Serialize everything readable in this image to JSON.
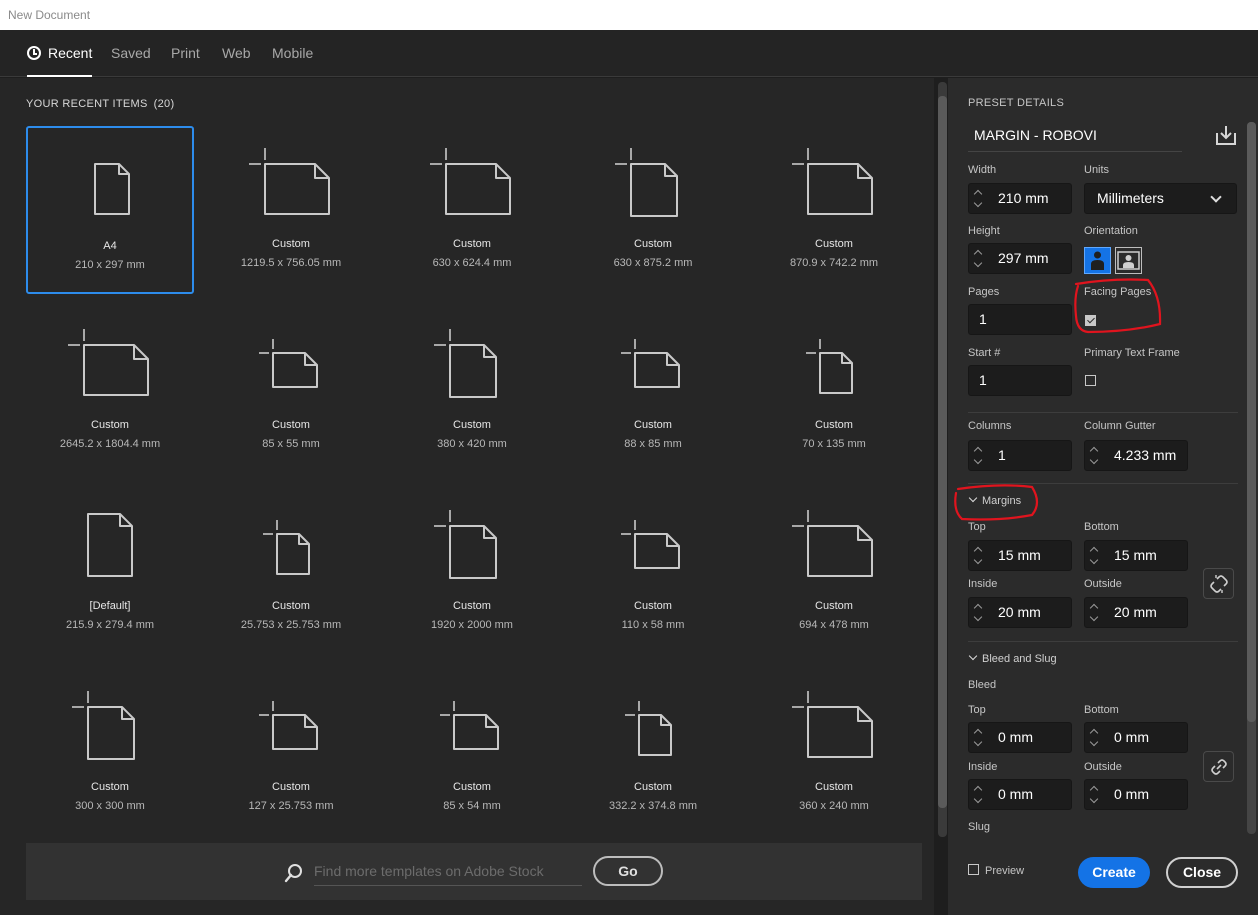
{
  "window": {
    "title": "New Document"
  },
  "tabs": [
    {
      "label": "Recent",
      "active": true
    },
    {
      "label": "Saved"
    },
    {
      "label": "Print"
    },
    {
      "label": "Web"
    },
    {
      "label": "Mobile"
    }
  ],
  "recent": {
    "title": "YOUR RECENT ITEMS",
    "count": "(20)",
    "items": [
      {
        "name": "A4",
        "size": "210 x 297 mm",
        "icon": "portrait-doc",
        "selected": true
      },
      {
        "name": "Custom",
        "size": "1219.5 x 756.05 mm",
        "icon": "custom-landscape"
      },
      {
        "name": "Custom",
        "size": "630 x 624.4 mm",
        "icon": "custom-landscape"
      },
      {
        "name": "Custom",
        "size": "630 x 875.2 mm",
        "icon": "custom-portrait"
      },
      {
        "name": "Custom",
        "size": "870.9 x 742.2 mm",
        "icon": "custom-landscape"
      },
      {
        "name": "Custom",
        "size": "2645.2 x 1804.4 mm",
        "icon": "custom-landscape"
      },
      {
        "name": "Custom",
        "size": "85 x 55 mm",
        "icon": "custom-small-landscape"
      },
      {
        "name": "Custom",
        "size": "380 x 420 mm",
        "icon": "custom-portrait"
      },
      {
        "name": "Custom",
        "size": "88 x 85 mm",
        "icon": "custom-small-landscape"
      },
      {
        "name": "Custom",
        "size": "70 x 135 mm",
        "icon": "custom-small-portrait"
      },
      {
        "name": "[Default]",
        "size": "215.9 x 279.4 mm",
        "icon": "portrait-doc-large"
      },
      {
        "name": "Custom",
        "size": "25.753 x 25.753 mm",
        "icon": "custom-small-portrait"
      },
      {
        "name": "Custom",
        "size": "1920 x 2000 mm",
        "icon": "custom-portrait"
      },
      {
        "name": "Custom",
        "size": "110 x 58 mm",
        "icon": "custom-small-landscape"
      },
      {
        "name": "Custom",
        "size": "694 x 478 mm",
        "icon": "custom-landscape"
      },
      {
        "name": "Custom",
        "size": "300 x 300 mm",
        "icon": "custom-portrait"
      },
      {
        "name": "Custom",
        "size": "127 x 25.753 mm",
        "icon": "custom-small-landscape"
      },
      {
        "name": "Custom",
        "size": "85 x 54 mm",
        "icon": "custom-small-landscape"
      },
      {
        "name": "Custom",
        "size": "332.2 x 374.8 mm",
        "icon": "custom-small-portrait"
      },
      {
        "name": "Custom",
        "size": "360 x 240 mm",
        "icon": "custom-landscape"
      }
    ]
  },
  "stock": {
    "placeholder": "Find more templates on Adobe Stock",
    "go_label": "Go",
    "icon": "search-icon"
  },
  "preset": {
    "section_title": "PRESET DETAILS",
    "name": "MARGIN - ROBOVI",
    "save_icon": "save-preset-icon",
    "width_label": "Width",
    "width_value": "210 mm",
    "units_label": "Units",
    "units_value": "Millimeters",
    "height_label": "Height",
    "height_value": "297 mm",
    "orientation_label": "Orientation",
    "orientation_selected": "portrait",
    "pages_label": "Pages",
    "pages_value": "1",
    "facing_label": "Facing Pages",
    "facing_checked": true,
    "start_label": "Start #",
    "start_value": "1",
    "ptf_label": "Primary Text Frame",
    "ptf_checked": false,
    "columns_label": "Columns",
    "columns_value": "1",
    "gutter_label": "Column Gutter",
    "gutter_value": "4.233 mm"
  },
  "margins": {
    "title": "Margins",
    "top_label": "Top",
    "top_value": "15 mm",
    "bottom_label": "Bottom",
    "bottom_value": "15 mm",
    "inside_label": "Inside",
    "inside_value": "20 mm",
    "outside_label": "Outside",
    "outside_value": "20 mm"
  },
  "bleed": {
    "title": "Bleed and Slug",
    "bleed_label": "Bleed",
    "top_label": "Top",
    "top_value": "0 mm",
    "bottom_label": "Bottom",
    "bottom_value": "0 mm",
    "inside_label": "Inside",
    "inside_value": "0 mm",
    "outside_label": "Outside",
    "outside_value": "0 mm",
    "slug_label": "Slug"
  },
  "footer": {
    "preview_label": "Preview",
    "create_label": "Create",
    "close_label": "Close"
  },
  "colors": {
    "accent": "#1473e6",
    "selection": "#2d8ceb",
    "annotation": "#e0141e"
  }
}
